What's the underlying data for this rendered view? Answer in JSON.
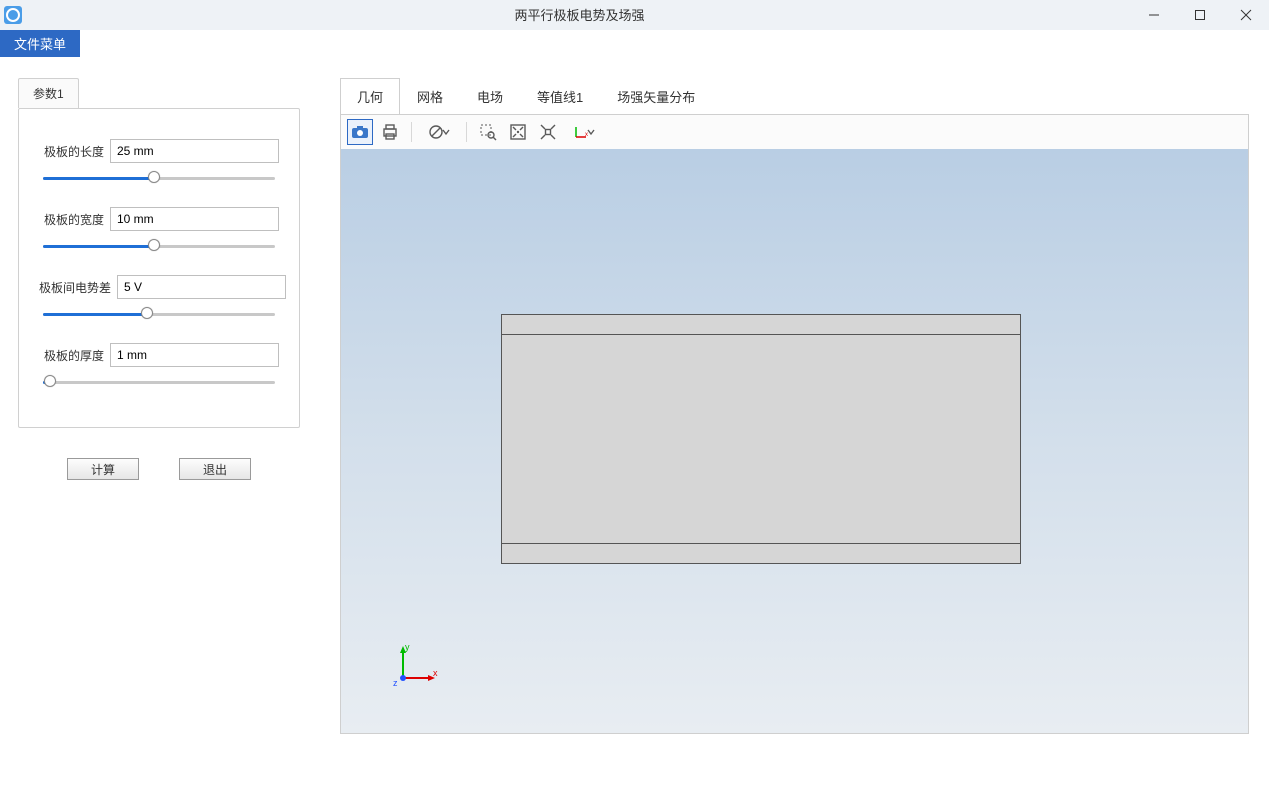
{
  "window": {
    "title": "两平行极板电势及场强"
  },
  "menubar": {
    "file_menu": "文件菜单"
  },
  "sidebar": {
    "tab": "参数1",
    "params": [
      {
        "label": "极板的长度",
        "value": "25 mm",
        "pct": 48
      },
      {
        "label": "极板的宽度",
        "value": "10 mm",
        "pct": 48
      },
      {
        "label": "极板间电势差",
        "value": "5 V",
        "pct": 45
      },
      {
        "label": "极板的厚度",
        "value": "1 mm",
        "pct": 3
      }
    ],
    "compute_btn": "计算",
    "exit_btn": "退出"
  },
  "viewport": {
    "tabs": [
      "几何",
      "网格",
      "电场",
      "等值线1",
      "场强矢量分布"
    ],
    "active_tab": 0,
    "axis": {
      "x": "x",
      "y": "y",
      "z": "z"
    }
  }
}
